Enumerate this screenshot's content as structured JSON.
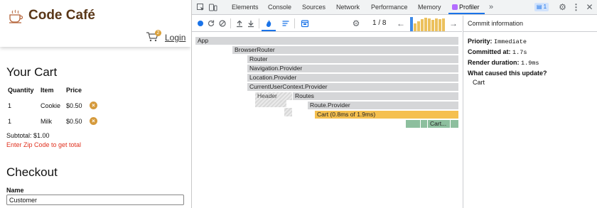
{
  "app": {
    "brand": "Code Café",
    "cart_count": "2",
    "login_label": "Login",
    "cart_heading": "Your Cart",
    "table": {
      "headers": [
        "Quantity",
        "Item",
        "Price"
      ],
      "rows": [
        {
          "quantity": "1",
          "item": "Cookie",
          "price": "$0.50"
        },
        {
          "quantity": "1",
          "item": "Milk",
          "price": "$0.50"
        }
      ]
    },
    "remove_glyph": "×",
    "subtotal": "Subtotal: $1.00",
    "zip_warning": "Enter Zip Code to get total",
    "checkout_heading": "Checkout",
    "name_label": "Name",
    "name_value": "Customer"
  },
  "devtools": {
    "tabs": [
      "Elements",
      "Console",
      "Sources",
      "Network",
      "Performance",
      "Memory",
      "Profiler"
    ],
    "active_tab": "Profiler",
    "overflow_glyph": "»",
    "message_count": "1",
    "commit_counter": "1 / 8",
    "commit_bar_heights": [
      1.0,
      0.55,
      0.7,
      0.85,
      0.95,
      0.9,
      0.8,
      0.9,
      0.85,
      0.9
    ],
    "flamegraph": [
      {
        "label": "App",
        "style": "gray"
      },
      {
        "label": "BrowserRouter",
        "style": "gray"
      },
      {
        "label": "Router",
        "style": "gray"
      },
      {
        "label": "Navigation.Provider",
        "style": "gray"
      },
      {
        "label": "Location.Provider",
        "style": "gray"
      },
      {
        "label": "CurrentUserContext.Provider",
        "style": "gray"
      },
      {
        "label": "Header",
        "style": "hatch"
      },
      {
        "label": "Routes",
        "style": "gray"
      },
      {
        "label": "Route.Provider",
        "style": "gray"
      },
      {
        "label": "Cart (0.8ms of 1.9ms)",
        "style": "yellow"
      },
      {
        "label": "Cart...",
        "style": "green"
      }
    ],
    "commit_info": {
      "title": "Commit information",
      "priority_label": "Priority:",
      "priority_value": "Immediate",
      "committed_label": "Committed at:",
      "committed_value": "1.7s",
      "render_label": "Render duration:",
      "render_value": "1.9ms",
      "cause_label": "What caused this update?",
      "cause_item": "Cart"
    },
    "colors": {
      "accent": "#1a73e8",
      "commit_bar": "#ecc15d",
      "commit_selected": "#3e89e6",
      "flame_yellow": "#f5c04f",
      "flame_green": "#8dbf9e",
      "brand": "#5a3718",
      "warning": "#e0301e"
    }
  }
}
